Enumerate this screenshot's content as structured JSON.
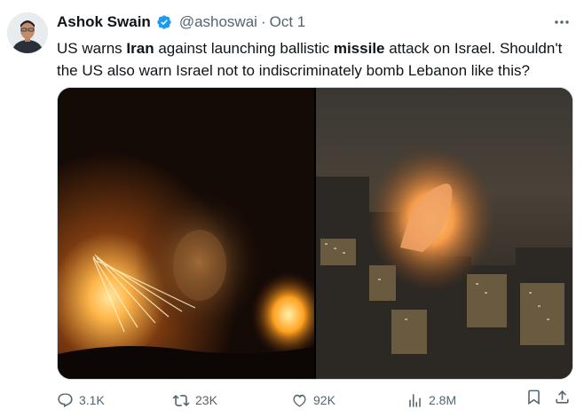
{
  "tweet": {
    "author": {
      "name": "Ashok Swain",
      "handle": "@ashoswai",
      "verified": true
    },
    "separator": "·",
    "date": "Oct 1",
    "text": {
      "part1": "US warns ",
      "bold1": "Iran",
      "part2": " against launching ballistic ",
      "bold2": "missile",
      "part3": " attack on Israel. Shouldn't the US also warn Israel not to indiscriminately bomb Lebanon like this?"
    },
    "media": {
      "count": 2,
      "items": [
        {
          "icon": "night-bombing-photo"
        },
        {
          "icon": "city-explosion-photo"
        }
      ]
    },
    "metrics": {
      "replies": "3.1K",
      "reposts": "23K",
      "likes": "92K",
      "views": "2.8M"
    }
  },
  "colors": {
    "text_primary": "#0f1419",
    "text_secondary": "#536471",
    "verified_blue": "#1d9bf0",
    "border": "#cfd9de"
  }
}
